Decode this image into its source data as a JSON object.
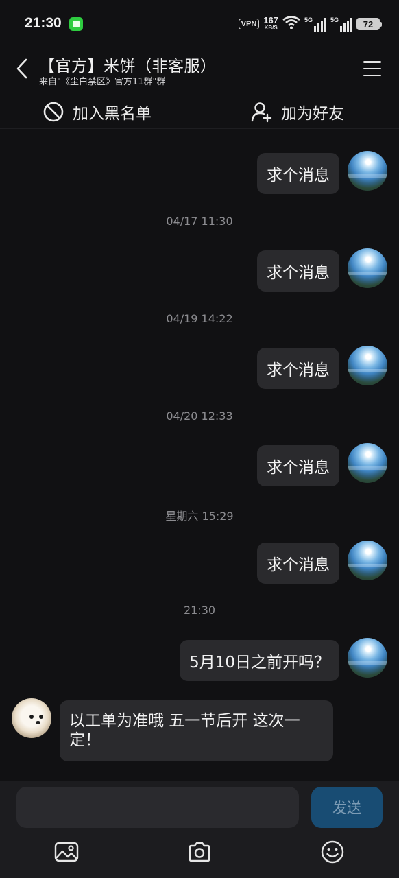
{
  "status_bar": {
    "time": "21:30",
    "vpn": "VPN",
    "net_speed_value": "167",
    "net_speed_unit": "KB/S",
    "sim1_tag": "5G",
    "sim2_tag": "5G",
    "battery": "72"
  },
  "header": {
    "title": "【官方】米饼（非客服）",
    "subtitle": "来自\"《尘白禁区》官方11群\"群"
  },
  "actions": {
    "blacklist_label": "加入黑名单",
    "add_friend_label": "加为好友"
  },
  "messages": [
    {
      "type": "out",
      "text": "求个消息"
    },
    {
      "type": "time",
      "text": "04/17 11:30"
    },
    {
      "type": "out",
      "text": "求个消息"
    },
    {
      "type": "time",
      "text": "04/19 14:22"
    },
    {
      "type": "out",
      "text": "求个消息"
    },
    {
      "type": "time",
      "text": "04/20 12:33"
    },
    {
      "type": "out",
      "text": "求个消息"
    },
    {
      "type": "time",
      "text": "星期六 15:29"
    },
    {
      "type": "out",
      "text": "求个消息"
    },
    {
      "type": "time",
      "text": "21:30"
    },
    {
      "type": "out",
      "text": "5月10日之前开吗？"
    },
    {
      "type": "in",
      "text": "以工单为准哦 五一节后开 这次一定！"
    }
  ],
  "composer": {
    "input_value": "",
    "send_label": "发送"
  },
  "toolbar": {
    "icons": [
      "image-icon",
      "camera-icon",
      "emoji-icon"
    ]
  },
  "colors": {
    "background": "#111113",
    "bubble": "#2a2a2d",
    "send_button": "#184c73",
    "timestamp": "#8c8c90"
  }
}
